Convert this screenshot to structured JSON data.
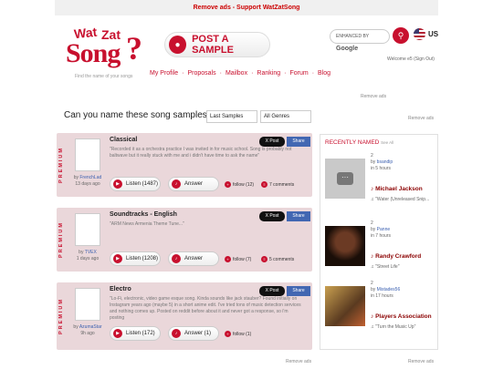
{
  "topbar": {
    "text": "Remove ads - Support WatZatSong"
  },
  "logo": {
    "wat": "Wat",
    "zat": "Zat",
    "song": "Song",
    "q": "?",
    "tagline": "Find the name of your songs"
  },
  "post": {
    "label": "POST A SAMPLE"
  },
  "search": {
    "label": "ENHANCED BY",
    "brand": "Google"
  },
  "lang": "US",
  "nav": [
    "My Profile",
    "Proposals",
    "Mailbox",
    "Ranking",
    "Forum",
    "Blog"
  ],
  "welcome": "Welcome e5 (Sign Out)",
  "ads": {
    "a1": "Remove ads",
    "a2": "Remove ads",
    "a3": "Remove ads",
    "a4": "Remove ads"
  },
  "question": "Can you name these song samples?",
  "filters": {
    "sort": "Last Samples",
    "genre": "All Genres"
  },
  "premium": "PREMIUM",
  "samples": [
    {
      "genre": "Classical",
      "desc": "\"Recorded it as a orchestra practice I was invited in for music school. Song is probably not baltwave but it really stuck with me and i didn't have time to ask the name\"",
      "by": "by",
      "user": "FrenchLad",
      "age": "13 days ago",
      "listen": "Listen (1487)",
      "answer": "Answer",
      "follow": "follow (12)",
      "comments": "7 comments",
      "x": "X Post",
      "share": "Share"
    },
    {
      "genre": "Soundtracks - English",
      "desc": "\"ARM News Armenia Theme Tune...\"",
      "by": "by",
      "user": "TVEX",
      "age": "1 days ago",
      "listen": "Listen (1208)",
      "answer": "Answer",
      "follow": "follow (7)",
      "comments": "5 comments",
      "x": "X Post",
      "share": "Share"
    },
    {
      "genre": "Electro",
      "desc": "\"Lo-Fi, electronic, video game esque song. Kinda sounds like jack stauber? Found initially on Instagram years ago (maybe 5) in a short anime edit. I've tried tons of music detection services and nothing comes up. Posted on reddit before about it and never got a response, so i'm posting",
      "by": "by",
      "user": "AzumaStar",
      "age": "9h ago",
      "listen": "Listen (172)",
      "answer": "Answer (1)",
      "follow": "follow (1)",
      "comments": "",
      "x": "X Post",
      "share": "Share"
    }
  ],
  "side": {
    "title": "RECENTLY NAMED",
    "seeall": "See All",
    "items": [
      {
        "num": "2",
        "by": "by",
        "user": "bsandip",
        "time": "in 5 hours",
        "artist": "Michael Jackson",
        "song": "\"Water (Unreleased Snip...",
        "color": "#c9c9c9"
      },
      {
        "num": "2",
        "by": "by",
        "user": "Panne",
        "time": "in 7 hours",
        "artist": "Randy Crawford",
        "song": "\"Street Life\"",
        "color": "#2a1a10"
      },
      {
        "num": "2",
        "by": "by",
        "user": "Mistades56",
        "time": "in 17 hours",
        "artist": "Players Association",
        "song": "\"Turn the Music Up\"",
        "color": "#6a5030"
      }
    ]
  }
}
